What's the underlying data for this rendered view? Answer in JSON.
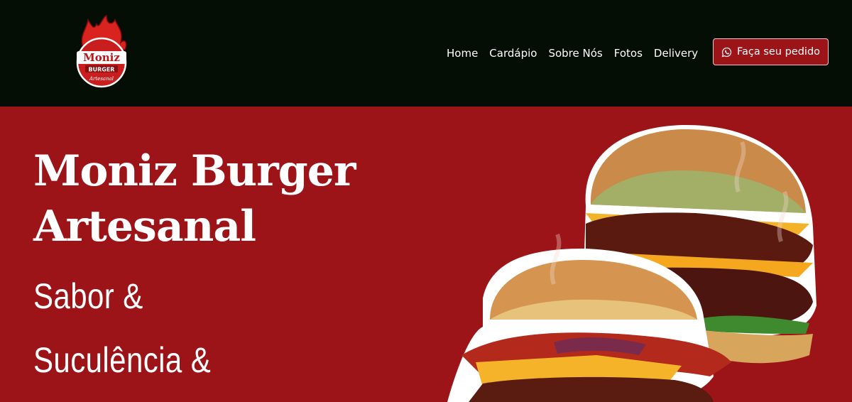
{
  "header": {
    "logo": {
      "brand_line1": "Moniz",
      "brand_line2": "BURGER",
      "brand_line3": "Artesanal",
      "icon": "flame-logo-icon"
    },
    "nav": [
      {
        "label": "Home"
      },
      {
        "label": "Cardápio"
      },
      {
        "label": "Sobre Nós"
      },
      {
        "label": "Fotos"
      },
      {
        "label": "Delivery"
      }
    ],
    "order_button": {
      "label": "Faça seu pedido",
      "icon": "whatsapp-icon"
    }
  },
  "hero": {
    "title_line1": "Moniz Burger",
    "title_line2": "Artesanal",
    "subtitle_line1": "Sabor &",
    "subtitle_line2": "Suculência &",
    "image": "burger-photo"
  },
  "colors": {
    "header_bg": "#050e05",
    "brand_red": "#9c1417",
    "text": "#ffffff"
  }
}
